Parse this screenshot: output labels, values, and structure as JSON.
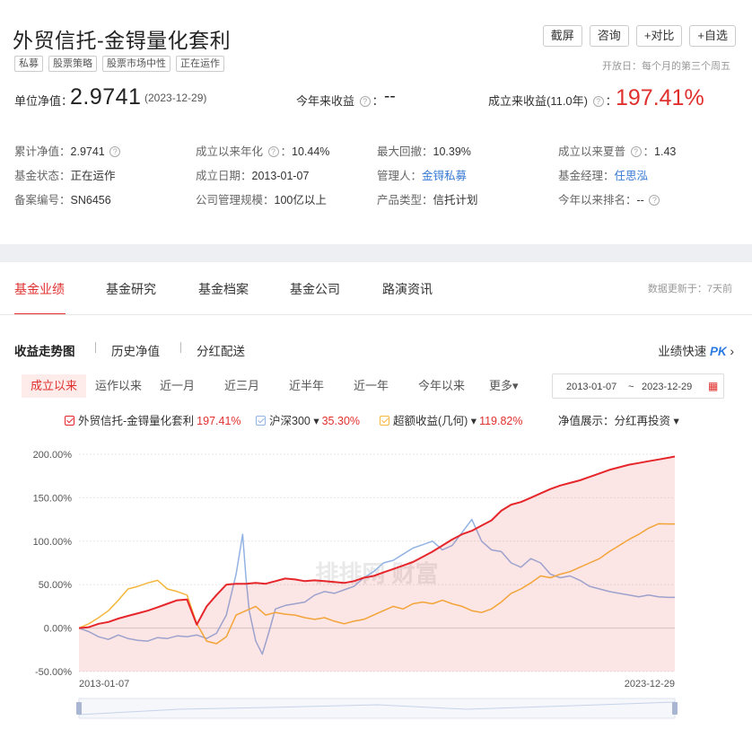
{
  "fund": {
    "name": "外贸信托-金锝量化套利",
    "tags": [
      "私募",
      "股票策略",
      "股票市场中性",
      "正在运作"
    ],
    "open_day": "开放日：每个月的第三个周五"
  },
  "actions": [
    "截屏",
    "咨询",
    "+对比",
    "+自选"
  ],
  "nav": {
    "unit_label": "单位净值：",
    "unit_value": "2.9741",
    "unit_date": "(2023-12-29)",
    "ytd_label": "今年来收益",
    "ytd_value": "--",
    "since_label": "成立来收益(11.0年)",
    "since_value": "197.41%"
  },
  "info": {
    "cum_nav_label": "累计净值：",
    "cum_nav": "2.9741",
    "annual_label": "成立以来年化",
    "annual": "10.44%",
    "maxdd_label": "最大回撤：",
    "maxdd": "10.39%",
    "sharpe_label": "成立以来夏普",
    "sharpe": "1.43",
    "status_label": "基金状态：",
    "status": "正在运作",
    "inception_label": "成立日期：",
    "inception": "2013-01-07",
    "manager_co_label": "管理人：",
    "manager_co": "金锝私募",
    "manager_label": "基金经理：",
    "manager": "任思泓",
    "reg_label": "备案编号：",
    "reg": "SN6456",
    "scale_label": "公司管理规模：",
    "scale": "100亿以上",
    "ptype_label": "产品类型：",
    "ptype": "信托计划",
    "rank_label": "今年以来排名：",
    "rank": "--"
  },
  "tabs": [
    "基金业绩",
    "基金研究",
    "基金档案",
    "基金公司",
    "路演资讯"
  ],
  "update_note": "数据更新于：7天前",
  "subtabs": [
    "收益走势图",
    "历史净值",
    "分红配送"
  ],
  "pk": {
    "label": "业绩快速",
    "pk": "PK"
  },
  "periods": [
    "成立以来",
    "运作以来",
    "近一月",
    "近三月",
    "近半年",
    "近一年",
    "今年以来",
    "更多▾"
  ],
  "date_range": {
    "start": "2013-01-07",
    "sep": "~",
    "end": "2023-12-29"
  },
  "legend": {
    "fund": {
      "name": "外贸信托-金锝量化套利",
      "pct": "197.41%"
    },
    "hs300": {
      "name": "沪深300 ▾",
      "pct": "35.30%"
    },
    "excess": {
      "name": "超额收益(几何) ▾",
      "pct": "119.82%"
    },
    "nav_show_label": "净值展示：",
    "nav_show_value": "分红再投资 ▾"
  },
  "chart_data": {
    "type": "line",
    "yticks": [
      "200.00%",
      "150.00%",
      "100.00%",
      "50.00%",
      "0.00%",
      "-50.00%"
    ],
    "ylim": [
      -50,
      200
    ],
    "x_start_label": "2013-01-07",
    "x_end_label": "2023-12-29",
    "watermark": "排排网 财富",
    "series": [
      {
        "name": "外贸信托-金锝量化套利",
        "color": "#e5262b",
        "fill": true,
        "points": [
          [
            0,
            0
          ],
          [
            3,
            1
          ],
          [
            6,
            5
          ],
          [
            9,
            7
          ],
          [
            12,
            11
          ],
          [
            15,
            14
          ],
          [
            18,
            17
          ],
          [
            21,
            20
          ],
          [
            24,
            24
          ],
          [
            27,
            28
          ],
          [
            30,
            32
          ],
          [
            33,
            33
          ],
          [
            36,
            4
          ],
          [
            39,
            25
          ],
          [
            42,
            38
          ],
          [
            45,
            50
          ],
          [
            48,
            51
          ],
          [
            51,
            51
          ],
          [
            54,
            52
          ],
          [
            57,
            51
          ],
          [
            60,
            54
          ],
          [
            63,
            57
          ],
          [
            66,
            56
          ],
          [
            69,
            54
          ],
          [
            72,
            55
          ],
          [
            75,
            54
          ],
          [
            78,
            53
          ],
          [
            81,
            52
          ],
          [
            84,
            54
          ],
          [
            87,
            58
          ],
          [
            90,
            60
          ],
          [
            93,
            64
          ],
          [
            96,
            68
          ],
          [
            99,
            72
          ],
          [
            102,
            76
          ],
          [
            105,
            82
          ],
          [
            108,
            88
          ],
          [
            111,
            95
          ],
          [
            114,
            102
          ],
          [
            117,
            108
          ],
          [
            120,
            112
          ],
          [
            123,
            118
          ],
          [
            126,
            124
          ],
          [
            129,
            135
          ],
          [
            132,
            142
          ],
          [
            135,
            145
          ],
          [
            138,
            150
          ],
          [
            141,
            155
          ],
          [
            144,
            160
          ],
          [
            147,
            164
          ],
          [
            150,
            167
          ],
          [
            153,
            170
          ],
          [
            156,
            174
          ],
          [
            159,
            178
          ],
          [
            162,
            182
          ],
          [
            165,
            185
          ],
          [
            168,
            188
          ],
          [
            171,
            190
          ],
          [
            174,
            192
          ],
          [
            177,
            194
          ],
          [
            180,
            196
          ],
          [
            182,
            197.41
          ]
        ]
      },
      {
        "name": "沪深300",
        "color": "#93b3e4",
        "fill": false,
        "points": [
          [
            0,
            0
          ],
          [
            3,
            -4
          ],
          [
            6,
            -10
          ],
          [
            9,
            -13
          ],
          [
            12,
            -8
          ],
          [
            15,
            -12
          ],
          [
            18,
            -14
          ],
          [
            21,
            -15
          ],
          [
            24,
            -11
          ],
          [
            27,
            -12
          ],
          [
            30,
            -9
          ],
          [
            33,
            -10
          ],
          [
            36,
            -8
          ],
          [
            39,
            -12
          ],
          [
            42,
            -6
          ],
          [
            45,
            15
          ],
          [
            48,
            62
          ],
          [
            50,
            108
          ],
          [
            51,
            58
          ],
          [
            52,
            20
          ],
          [
            54,
            -15
          ],
          [
            56,
            -30
          ],
          [
            58,
            -5
          ],
          [
            60,
            22
          ],
          [
            63,
            26
          ],
          [
            66,
            28
          ],
          [
            69,
            30
          ],
          [
            72,
            38
          ],
          [
            75,
            42
          ],
          [
            78,
            40
          ],
          [
            81,
            44
          ],
          [
            84,
            48
          ],
          [
            87,
            58
          ],
          [
            90,
            65
          ],
          [
            93,
            75
          ],
          [
            96,
            78
          ],
          [
            99,
            85
          ],
          [
            102,
            92
          ],
          [
            105,
            96
          ],
          [
            108,
            100
          ],
          [
            111,
            90
          ],
          [
            114,
            95
          ],
          [
            117,
            110
          ],
          [
            120,
            125
          ],
          [
            123,
            100
          ],
          [
            126,
            90
          ],
          [
            129,
            88
          ],
          [
            132,
            75
          ],
          [
            135,
            70
          ],
          [
            138,
            80
          ],
          [
            141,
            75
          ],
          [
            144,
            62
          ],
          [
            147,
            58
          ],
          [
            150,
            60
          ],
          [
            153,
            55
          ],
          [
            156,
            48
          ],
          [
            159,
            45
          ],
          [
            162,
            42
          ],
          [
            165,
            40
          ],
          [
            168,
            38
          ],
          [
            171,
            36
          ],
          [
            174,
            38
          ],
          [
            177,
            36
          ],
          [
            180,
            35.3
          ],
          [
            182,
            35.3
          ]
        ]
      },
      {
        "name": "超额收益(几何)",
        "color": "#f5b63c",
        "fill": false,
        "points": [
          [
            0,
            0
          ],
          [
            3,
            5
          ],
          [
            6,
            12
          ],
          [
            9,
            20
          ],
          [
            12,
            32
          ],
          [
            15,
            45
          ],
          [
            18,
            48
          ],
          [
            21,
            52
          ],
          [
            24,
            55
          ],
          [
            27,
            45
          ],
          [
            30,
            42
          ],
          [
            33,
            38
          ],
          [
            36,
            5
          ],
          [
            39,
            -15
          ],
          [
            42,
            -18
          ],
          [
            45,
            -10
          ],
          [
            48,
            15
          ],
          [
            51,
            20
          ],
          [
            54,
            25
          ],
          [
            57,
            15
          ],
          [
            60,
            18
          ],
          [
            63,
            16
          ],
          [
            66,
            15
          ],
          [
            69,
            12
          ],
          [
            72,
            10
          ],
          [
            75,
            12
          ],
          [
            78,
            8
          ],
          [
            81,
            5
          ],
          [
            84,
            8
          ],
          [
            87,
            10
          ],
          [
            90,
            15
          ],
          [
            93,
            20
          ],
          [
            96,
            25
          ],
          [
            99,
            22
          ],
          [
            102,
            28
          ],
          [
            105,
            30
          ],
          [
            108,
            28
          ],
          [
            111,
            32
          ],
          [
            114,
            28
          ],
          [
            117,
            25
          ],
          [
            120,
            20
          ],
          [
            123,
            18
          ],
          [
            126,
            22
          ],
          [
            129,
            30
          ],
          [
            132,
            40
          ],
          [
            135,
            45
          ],
          [
            138,
            52
          ],
          [
            141,
            60
          ],
          [
            144,
            58
          ],
          [
            147,
            62
          ],
          [
            150,
            65
          ],
          [
            153,
            70
          ],
          [
            156,
            75
          ],
          [
            159,
            80
          ],
          [
            162,
            88
          ],
          [
            165,
            95
          ],
          [
            168,
            102
          ],
          [
            171,
            108
          ],
          [
            174,
            115
          ],
          [
            177,
            120
          ],
          [
            180,
            119.82
          ],
          [
            182,
            119.82
          ]
        ]
      }
    ]
  }
}
